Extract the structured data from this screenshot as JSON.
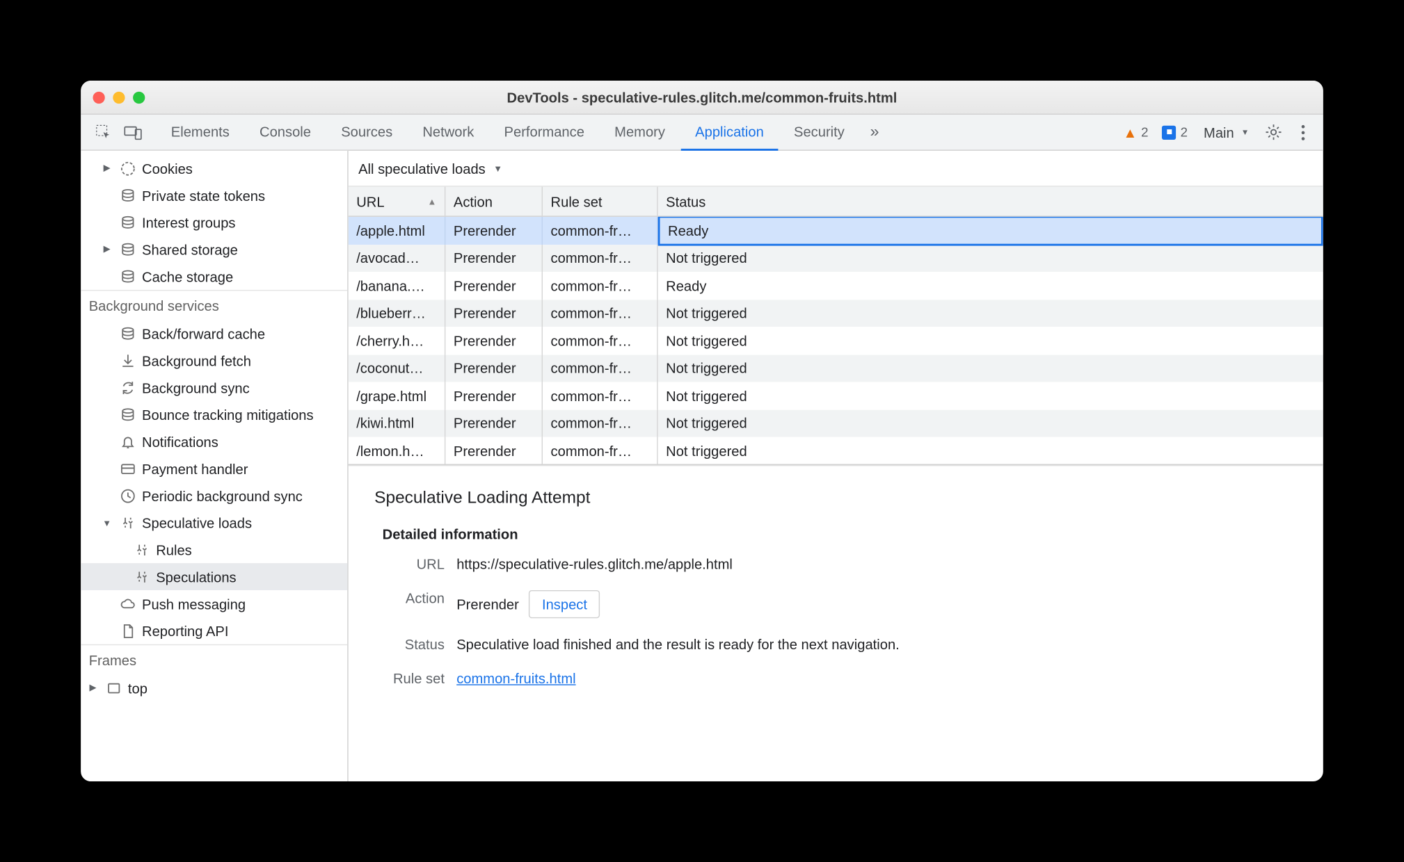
{
  "window": {
    "title": "DevTools - speculative-rules.glitch.me/common-fruits.html"
  },
  "tabs": {
    "items": [
      "Elements",
      "Console",
      "Sources",
      "Network",
      "Performance",
      "Memory",
      "Application",
      "Security"
    ],
    "active_index": 6,
    "overflow_glyph": "»",
    "warnings_count": "2",
    "issues_count": "2",
    "target_label": "Main"
  },
  "sidebar": {
    "storage": [
      {
        "label": "Cookies",
        "icon": "cookie",
        "expandable": true
      },
      {
        "label": "Private state tokens",
        "icon": "db"
      },
      {
        "label": "Interest groups",
        "icon": "db"
      },
      {
        "label": "Shared storage",
        "icon": "db",
        "expandable": true
      },
      {
        "label": "Cache storage",
        "icon": "db"
      }
    ],
    "bg_header": "Background services",
    "bg": [
      {
        "label": "Back/forward cache",
        "icon": "db"
      },
      {
        "label": "Background fetch",
        "icon": "fetch"
      },
      {
        "label": "Background sync",
        "icon": "sync"
      },
      {
        "label": "Bounce tracking mitigations",
        "icon": "db"
      },
      {
        "label": "Notifications",
        "icon": "bell"
      },
      {
        "label": "Payment handler",
        "icon": "card"
      },
      {
        "label": "Periodic background sync",
        "icon": "clock"
      },
      {
        "label": "Speculative loads",
        "icon": "spec",
        "expandable": true,
        "expanded": true
      },
      {
        "label": "Rules",
        "icon": "spec",
        "child": true
      },
      {
        "label": "Speculations",
        "icon": "spec",
        "child": true,
        "selected": true
      },
      {
        "label": "Push messaging",
        "icon": "cloud"
      },
      {
        "label": "Reporting API",
        "icon": "doc"
      }
    ],
    "frames_header": "Frames",
    "frames": [
      {
        "label": "top",
        "icon": "frame",
        "expandable": true
      }
    ]
  },
  "filter_label": "All speculative loads",
  "columns": {
    "url": "URL",
    "action": "Action",
    "ruleset": "Rule set",
    "status": "Status"
  },
  "rows": [
    {
      "url": "/apple.html",
      "action": "Prerender",
      "ruleset": "common-fr…",
      "status": "Ready",
      "selected": true
    },
    {
      "url": "/avocad…",
      "action": "Prerender",
      "ruleset": "common-fr…",
      "status": "Not triggered"
    },
    {
      "url": "/banana.…",
      "action": "Prerender",
      "ruleset": "common-fr…",
      "status": "Ready"
    },
    {
      "url": "/blueberr…",
      "action": "Prerender",
      "ruleset": "common-fr…",
      "status": "Not triggered"
    },
    {
      "url": "/cherry.h…",
      "action": "Prerender",
      "ruleset": "common-fr…",
      "status": "Not triggered"
    },
    {
      "url": "/coconut…",
      "action": "Prerender",
      "ruleset": "common-fr…",
      "status": "Not triggered"
    },
    {
      "url": "/grape.html",
      "action": "Prerender",
      "ruleset": "common-fr…",
      "status": "Not triggered"
    },
    {
      "url": "/kiwi.html",
      "action": "Prerender",
      "ruleset": "common-fr…",
      "status": "Not triggered"
    },
    {
      "url": "/lemon.h…",
      "action": "Prerender",
      "ruleset": "common-fr…",
      "status": "Not triggered"
    }
  ],
  "details": {
    "title": "Speculative Loading Attempt",
    "subtitle": "Detailed information",
    "url_label": "URL",
    "url_value": "https://speculative-rules.glitch.me/apple.html",
    "action_label": "Action",
    "action_value": "Prerender",
    "inspect_label": "Inspect",
    "status_label": "Status",
    "status_value": "Speculative load finished and the result is ready for the next navigation.",
    "ruleset_label": "Rule set",
    "ruleset_link": "common-fruits.html"
  }
}
